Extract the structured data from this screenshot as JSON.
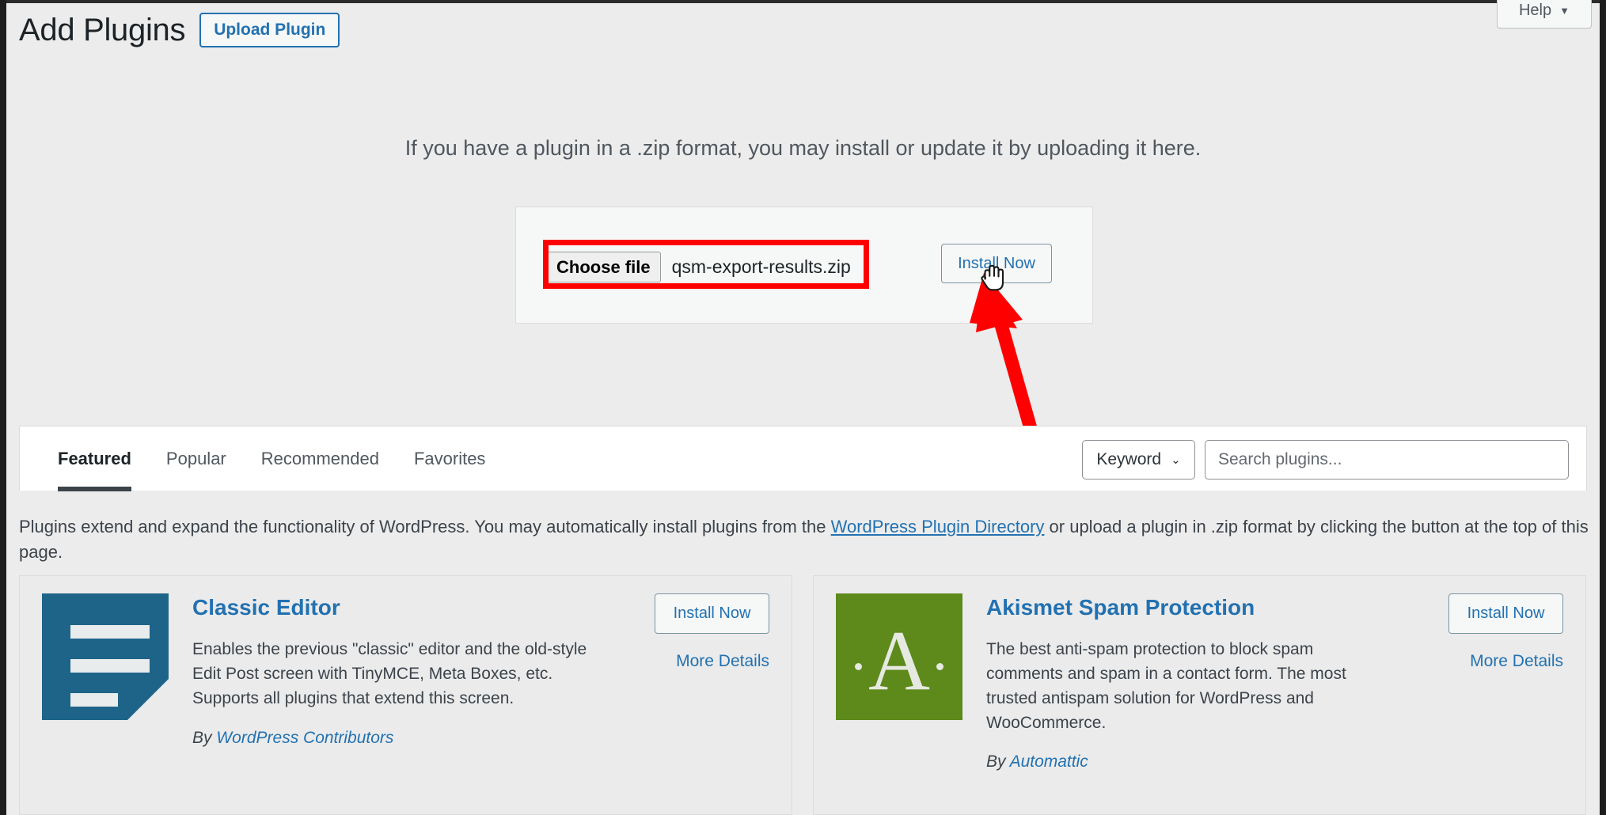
{
  "header": {
    "page_title": "Add Plugins",
    "upload_plugin_label": "Upload Plugin",
    "help_label": "Help",
    "help_caret": "▼"
  },
  "upload": {
    "hint": "If you have a plugin in a .zip format, you may install or update it by uploading it here.",
    "choose_file_label": "Choose file",
    "file_name": "qsm-export-results.zip",
    "install_now_label": "Install Now",
    "highlight_color": "#ff0000",
    "arrow_color": "#ff0000"
  },
  "tabs": [
    {
      "label": "Featured",
      "active": true
    },
    {
      "label": "Popular",
      "active": false
    },
    {
      "label": "Recommended",
      "active": false
    },
    {
      "label": "Favorites",
      "active": false
    }
  ],
  "search": {
    "type_label": "Keyword",
    "chevron": "⌄",
    "placeholder": "Search plugins...",
    "value": ""
  },
  "description": {
    "part1": "Plugins extend and expand the functionality of WordPress. You may automatically install plugins from the ",
    "link": "WordPress Plugin Directory",
    "part2": " or upload a plugin in .zip format by clicking the button at the top of this page."
  },
  "plugins": [
    {
      "name": "Classic Editor",
      "description": "Enables the previous \"classic\" editor and the old-style Edit Post screen with TinyMCE, Meta Boxes, etc. Supports all plugins that extend this screen.",
      "by_prefix": "By ",
      "author": "WordPress Contributors",
      "install_label": "Install Now",
      "more_details_label": "More Details",
      "icon": "document-icon",
      "icon_color": "#1e6489"
    },
    {
      "name": "Akismet Spam Protection",
      "description": "The best anti-spam protection to block spam comments and spam in a contact form. The most trusted antispam solution for WordPress and WooCommerce.",
      "by_prefix": "By ",
      "author": "Automattic",
      "install_label": "Install Now",
      "more_details_label": "More Details",
      "icon": "letter-a-icon",
      "icon_color": "#5d8a1b",
      "icon_letter": "A"
    }
  ]
}
